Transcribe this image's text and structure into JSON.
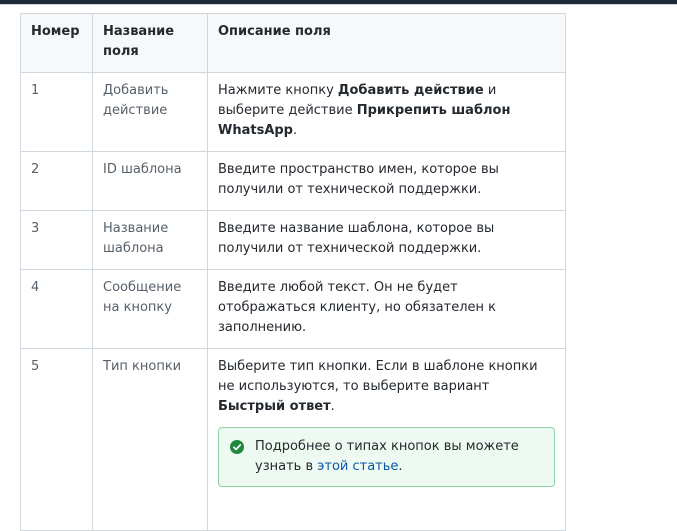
{
  "table": {
    "headers": [
      "Номер",
      "Название поля",
      "Описание поля"
    ],
    "rows": [
      {
        "num": "1",
        "name": "Добавить действие",
        "desc": {
          "t1": "Нажмите кнопку ",
          "b1": "Добавить действие",
          "t2": " и выберите действие ",
          "b2": "Прикрепить шаблон WhatsApp",
          "t3": "."
        }
      },
      {
        "num": "2",
        "name": "ID шаблона",
        "desc": {
          "text": "Введите пространство имен, которое вы получили от технической поддержки."
        }
      },
      {
        "num": "3",
        "name": "Название шаблона",
        "desc": {
          "text": "Введите название шаблона, которое вы получили от технической поддержки."
        }
      },
      {
        "num": "4",
        "name": "Сообщение на кнопку",
        "desc": {
          "text": "Введите любой текст. Он не будет отображаться клиенту, но обязателен к заполнению."
        }
      },
      {
        "num": "5",
        "name": "Тип кнопки",
        "desc": {
          "t1": "Выберите тип кнопки. Если в шаблоне кнопки не используются, то выберите вариант ",
          "b1": "Быстрый ответ",
          "t2": "."
        },
        "note": {
          "icon": "check-circle-icon",
          "text": "Подробнее о типах кнопок вы можете узнать в ",
          "link": "этой статье",
          "after": "."
        }
      }
    ]
  },
  "colors": {
    "note_bg": "#eef9f1",
    "note_border": "#8bd2a3",
    "note_icon": "#1f883d",
    "link": "#0a58a8"
  }
}
